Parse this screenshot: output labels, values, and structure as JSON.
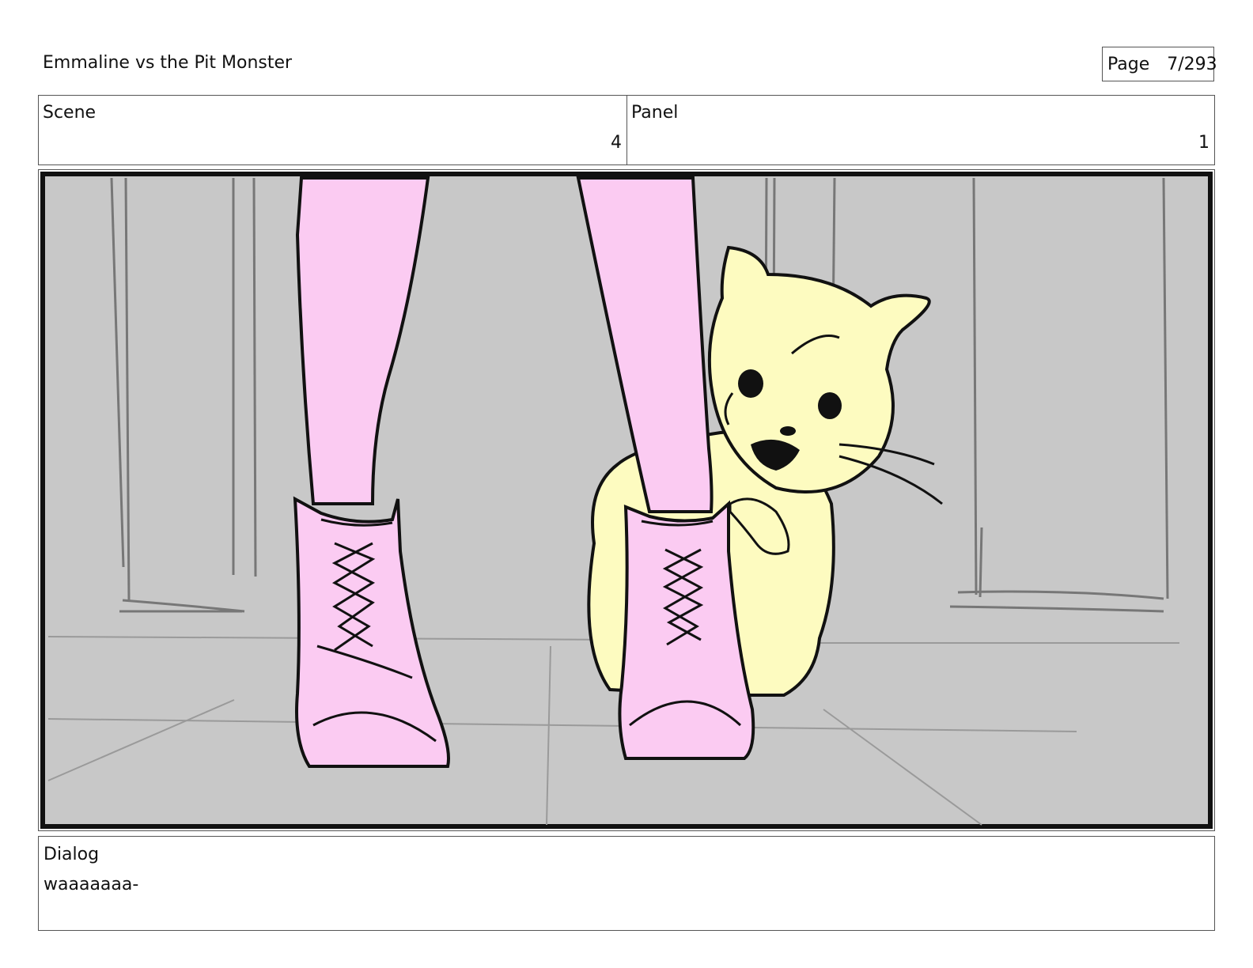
{
  "document": {
    "title": "Emmaline vs the Pit Monster",
    "page_label": "Page",
    "page_value": "7/293"
  },
  "header": {
    "scene_label": "Scene",
    "scene_value": "4",
    "panel_label": "Panel",
    "panel_value": "1"
  },
  "illustration": {
    "subject": "storyboard-sketch-pink-boots-yellow-hamster",
    "colors": {
      "background": "#c8c8c8",
      "legs": "#fbcbf2",
      "hamster": "#fdfbc0",
      "outline": "#111111"
    }
  },
  "dialog": {
    "label": "Dialog",
    "text": "waaaaaaa-"
  }
}
